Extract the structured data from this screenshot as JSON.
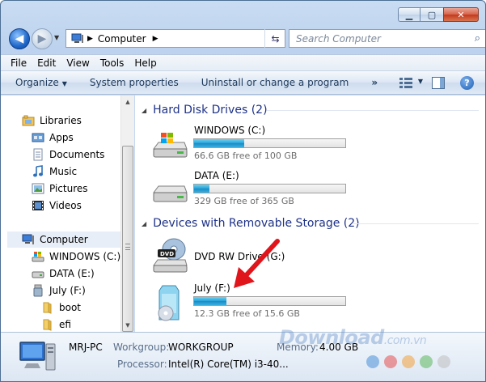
{
  "address": {
    "crumb": "Computer"
  },
  "search": {
    "placeholder": "Search Computer"
  },
  "menu": [
    "File",
    "Edit",
    "View",
    "Tools",
    "Help"
  ],
  "commands": {
    "organize": "Organize",
    "system_properties": "System properties",
    "uninstall": "Uninstall or change a program",
    "more": "»"
  },
  "nav": {
    "libraries": "Libraries",
    "apps": "Apps",
    "documents": "Documents",
    "music": "Music",
    "pictures": "Pictures",
    "videos": "Videos",
    "computer": "Computer",
    "windows_c": "WINDOWS (C:)",
    "data_e": "DATA (E:)",
    "july_f": "July (F:)",
    "boot": "boot",
    "efi": "efi"
  },
  "groups": {
    "hdd": "Hard Disk Drives (2)",
    "removable": "Devices with Removable Storage (2)"
  },
  "drives": [
    {
      "name": "WINDOWS (C:)",
      "free_text": "66.6 GB free of 100 GB",
      "used_fraction": 0.334
    },
    {
      "name": "DATA (E:)",
      "free_text": "329 GB free of 365 GB",
      "used_fraction": 0.099
    },
    {
      "name": "DVD RW Drive (G:)"
    },
    {
      "name": "July (F:)",
      "free_text": "12.3 GB free of 15.6 GB",
      "used_fraction": 0.212
    }
  ],
  "details": {
    "pc_name": "MRJ-PC",
    "workgroup_label": "Workgroup:",
    "workgroup": "WORKGROUP",
    "memory_label": "Memory:",
    "memory": "4.00 GB",
    "processor_label": "Processor:",
    "processor": "Intel(R) Core(TM) i3-40..."
  },
  "watermark": {
    "text": "Download",
    "suffix": ".com.vn"
  },
  "colors": {
    "accent": "#1e3287",
    "bar": "#26a0da",
    "arrow": "#e0151b",
    "dots": [
      "#4a90d9",
      "#e85050",
      "#f4a13a",
      "#5cb85c",
      "#c0c0c0"
    ]
  }
}
